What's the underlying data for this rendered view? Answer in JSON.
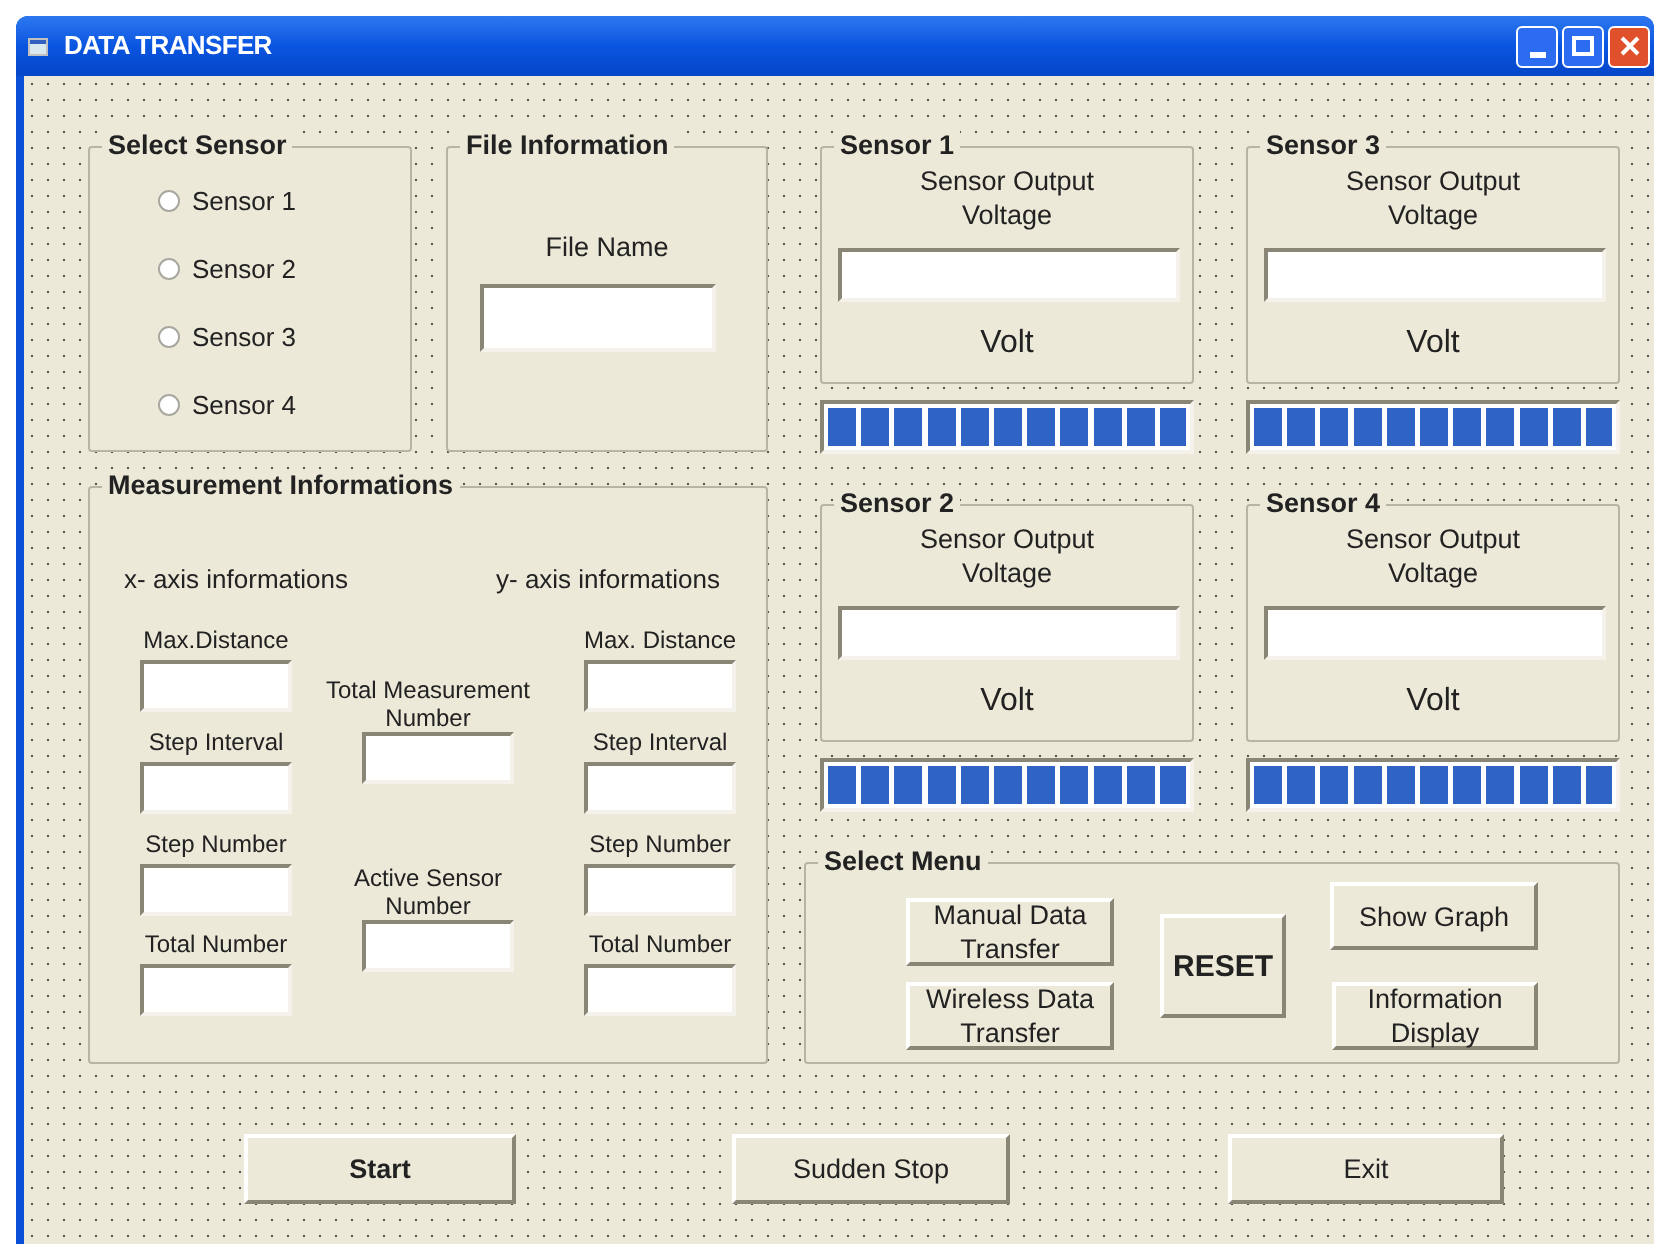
{
  "window": {
    "title": "DATA TRANSFER"
  },
  "select_sensor": {
    "title": "Select Sensor",
    "options": [
      {
        "label": "Sensor 1",
        "selected": false
      },
      {
        "label": "Sensor 2",
        "selected": false
      },
      {
        "label": "Sensor 3",
        "selected": false
      },
      {
        "label": "Sensor 4",
        "selected": false
      }
    ]
  },
  "file_information": {
    "title": "File Information",
    "label": "File Name"
  },
  "measurement": {
    "title": "Measurement Informations",
    "x_axis_label": "x- axis informations",
    "y_axis_label": "y- axis informations",
    "x_fields": [
      "Max.Distance",
      "Step Interval",
      "Step Number",
      "Total Number"
    ],
    "center_fields": [
      "Total Measurement Number",
      "Active Sensor Number"
    ],
    "y_fields": [
      "Max. Distance",
      "Step Interval",
      "Step Number",
      "Total Number"
    ]
  },
  "sensors": [
    {
      "title": "Sensor 1",
      "caption": "Sensor Output Voltage",
      "unit": "Volt",
      "level": 1
    },
    {
      "title": "Sensor 3",
      "caption": "Sensor Output Voltage",
      "unit": "Volt",
      "level": 1
    },
    {
      "title": "Sensor 2",
      "caption": "Sensor Output Voltage",
      "unit": "Volt",
      "level": 1
    },
    {
      "title": "Sensor 4",
      "caption": "Sensor Output Voltage",
      "unit": "Volt",
      "level": 1
    }
  ],
  "select_menu": {
    "title": "Select Menu",
    "buttons": [
      {
        "label": "Manual Data Transfer",
        "emphasized": false
      },
      {
        "label": "Wireless Data Transfer",
        "emphasized": false
      },
      {
        "label": "RESET",
        "emphasized": true
      },
      {
        "label": "Show Graph",
        "emphasized": false
      },
      {
        "label": "Information Display",
        "emphasized": false
      }
    ]
  },
  "bottom_buttons": [
    {
      "label": "Start",
      "emphasized": true
    },
    {
      "label": "Sudden Stop",
      "emphasized": false
    },
    {
      "label": "Exit",
      "emphasized": false
    }
  ]
}
